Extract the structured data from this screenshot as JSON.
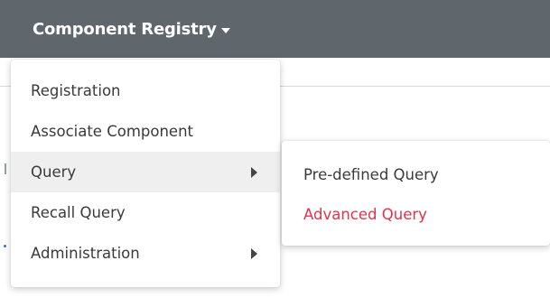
{
  "navbar": {
    "title": "Component Registry",
    "caret_icon": "caret-down-icon",
    "background": "#5f666c"
  },
  "main_menu": {
    "items": [
      {
        "label": "Registration",
        "has_submenu": false
      },
      {
        "label": "Associate Component",
        "has_submenu": false
      },
      {
        "label": "Query",
        "has_submenu": true,
        "active": true
      },
      {
        "label": "Recall Query",
        "has_submenu": false
      },
      {
        "label": "Administration",
        "has_submenu": true
      }
    ]
  },
  "submenu": {
    "parent": "Query",
    "items": [
      {
        "label": "Pre-defined Query",
        "highlighted": false
      },
      {
        "label": "Advanced Query",
        "highlighted": true
      }
    ]
  },
  "colors": {
    "active_row": "#efefef",
    "highlight_text": "#e2334d"
  }
}
